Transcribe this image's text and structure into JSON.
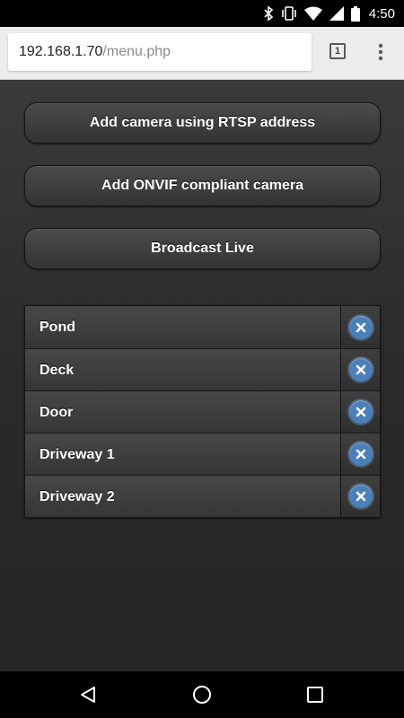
{
  "status_bar": {
    "time": "4:50",
    "icons": [
      "bluetooth-icon",
      "vibrate-icon",
      "wifi-icon",
      "signal-icon",
      "battery-icon"
    ]
  },
  "browser": {
    "url_host": "192.168.1.70",
    "url_path": "/menu.php",
    "tab_count": "1",
    "menu_icon": "overflow-menu-icon"
  },
  "actions": {
    "rtsp_label": "Add camera using RTSP address",
    "onvif_label": "Add ONVIF compliant camera",
    "live_label": "Broadcast Live"
  },
  "cameras": [
    {
      "name": "Pond"
    },
    {
      "name": "Deck"
    },
    {
      "name": "Door"
    },
    {
      "name": "Driveway 1"
    },
    {
      "name": "Driveway 2"
    }
  ],
  "colors": {
    "delete_accent": "#4a7fb8",
    "background": "#2c2c2c"
  },
  "nav_bar": {
    "icons": [
      "back-icon",
      "home-icon",
      "recents-icon"
    ]
  }
}
